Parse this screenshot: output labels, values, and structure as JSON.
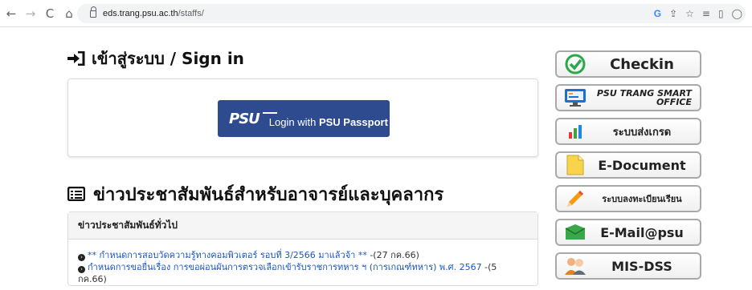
{
  "browser": {
    "url_domain": "eds.trang.psu.ac.th",
    "url_path": "/staffs/",
    "translate_badge": "G"
  },
  "signin": {
    "heading": "เข้าสู่ระบบ / Sign in",
    "psu_logo": "PSU",
    "login_prefix": "Login with ",
    "login_bold": "PSU Passport"
  },
  "news": {
    "heading": "ข่าวประชาสัมพันธ์สำหรับอาจารย์และบุคลากร",
    "card_title": "ข่าวประชาสัมพันธ์ทั่วไป",
    "items": [
      {
        "text": "** กำหนดการสอบวัดความรู้ทางคอมพิวเตอร์ รอบที่ 3/2566 มาแล้วจ้า **",
        "date": " -(27 กค.66)"
      },
      {
        "text": "กำหนดการขอยื่นเรื่อง การขอผ่อนผันการตรวจเลือกเข้ารับราชการทหาร ฯ (การเกณฑ์ทหาร) พ.ศ. 2567",
        "date": " -(5 กค.66)"
      }
    ]
  },
  "side_buttons": [
    {
      "label": "Checkin",
      "icon": "check-circle-icon"
    },
    {
      "label": "PSU TRANG SMART OFFICE",
      "icon": "monitor-icon"
    },
    {
      "label": "ระบบส่งเกรด",
      "icon": "bar-chart-icon"
    },
    {
      "label": "E-Document",
      "icon": "document-icon"
    },
    {
      "label": "ระบบลงทะเบียนเรียน",
      "icon": "pencil-icon"
    },
    {
      "label": "E-Mail@psu",
      "icon": "envelope-icon"
    },
    {
      "label": "MIS-DSS",
      "icon": "users-icon"
    }
  ],
  "colors": {
    "psu_blue": "#2e4b8f",
    "link": "#1a55c0",
    "check_green": "#2aa84a"
  }
}
